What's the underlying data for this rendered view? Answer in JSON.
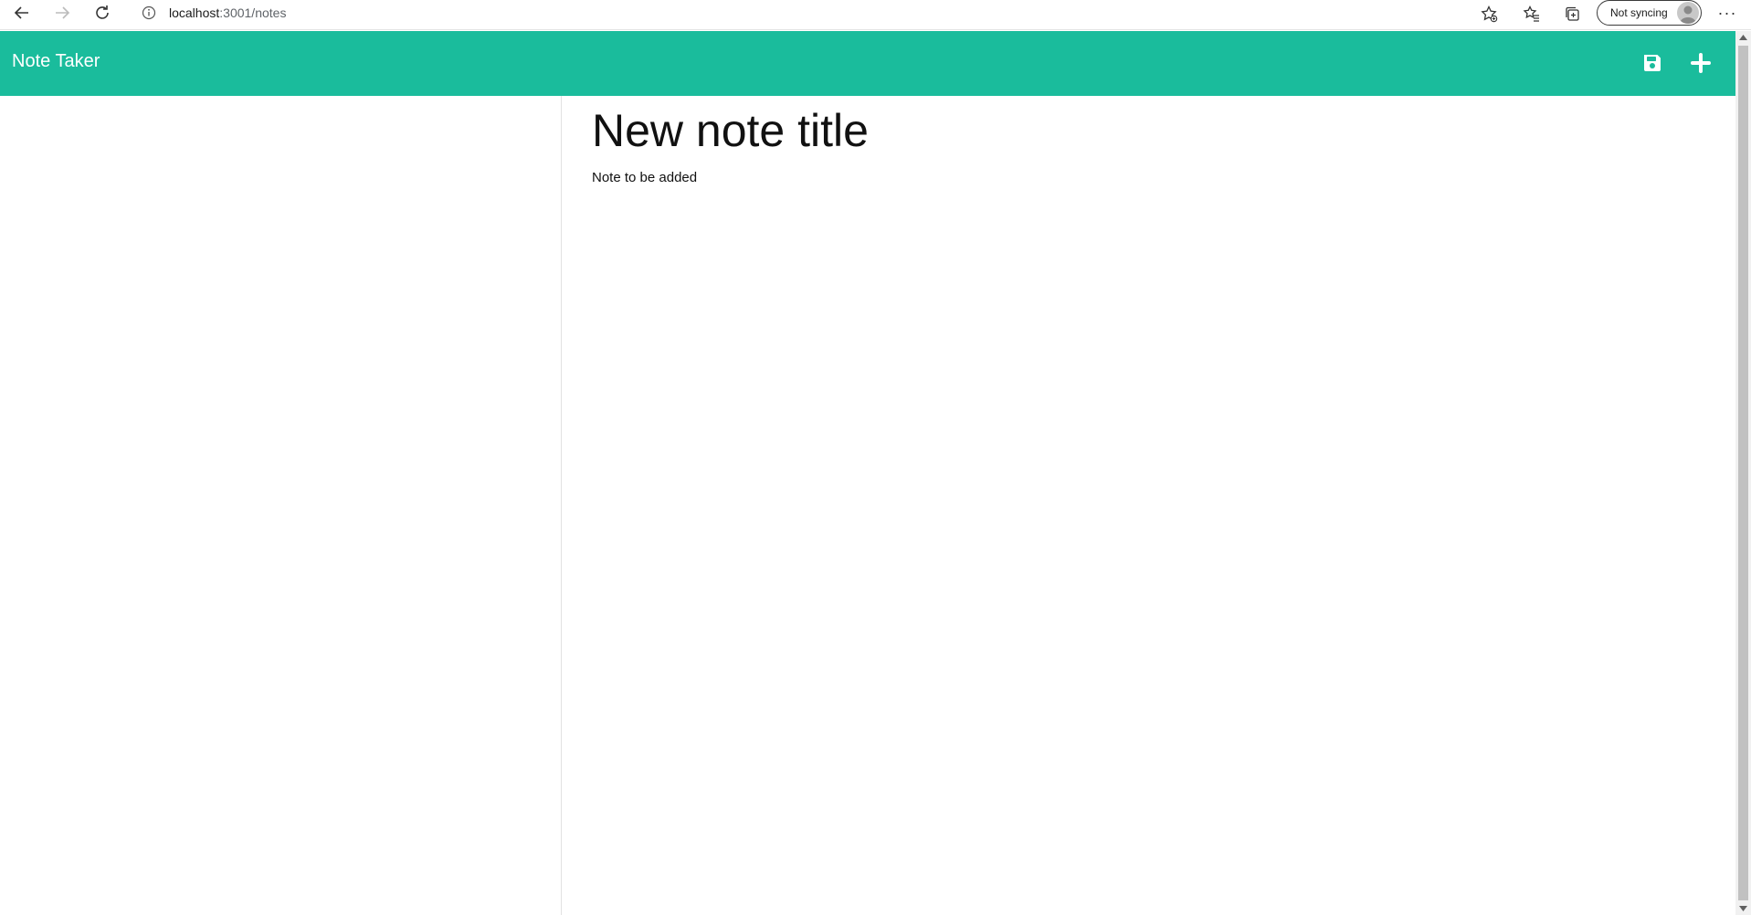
{
  "browser": {
    "url_host": "localhost",
    "url_path": ":3001/notes",
    "sync_label": "Not syncing",
    "more_label": "···"
  },
  "app": {
    "title": "Note Taker",
    "accent_color": "#1abc9c"
  },
  "editor": {
    "title_value": "New note title",
    "text_value": "Note to be added"
  },
  "icons": {
    "save": "save-icon",
    "add": "plus-icon"
  }
}
